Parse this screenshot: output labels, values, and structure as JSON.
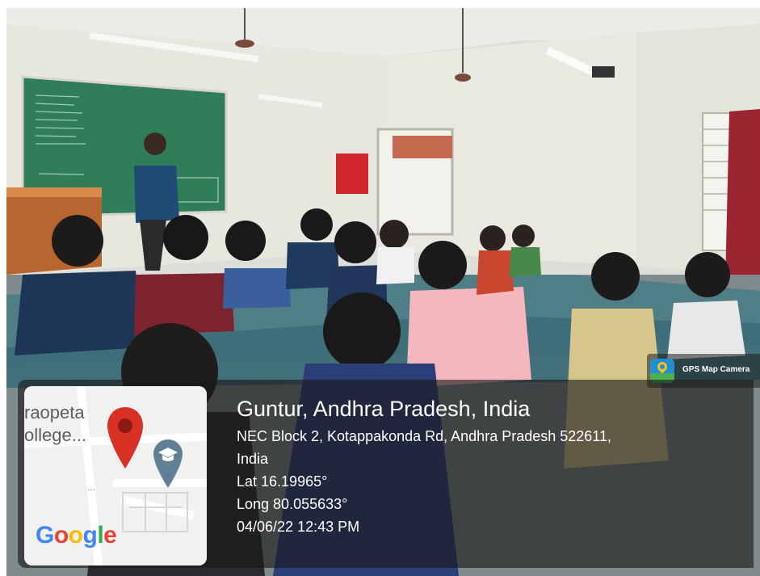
{
  "location": {
    "title": "Guntur, Andhra Pradesh, India",
    "address_line1": "NEC Block 2, Kotappakonda Rd, Andhra Pradesh 522611,",
    "address_line2": "India",
    "latitude": "Lat 16.19965°",
    "longitude": "Long 80.055633°",
    "timestamp": "04/06/22 12:43 PM"
  },
  "badge": {
    "label": "GPS Map Camera",
    "icon": "gps-map-camera-icon"
  },
  "map": {
    "label_top": "raopeta",
    "label_bottom": "ollege...",
    "dots": "...",
    "logo_letters": [
      "G",
      "o",
      "o",
      "g",
      "l",
      "e"
    ],
    "logo_colors": [
      "#4285F4",
      "#EA4335",
      "#FBBC05",
      "#4285F4",
      "#34A853",
      "#EA4335"
    ],
    "pin_icon": "location-pin-icon",
    "pin_color": "#d93025",
    "school_icon": "school-marker-icon",
    "school_color": "#5f7f95"
  }
}
